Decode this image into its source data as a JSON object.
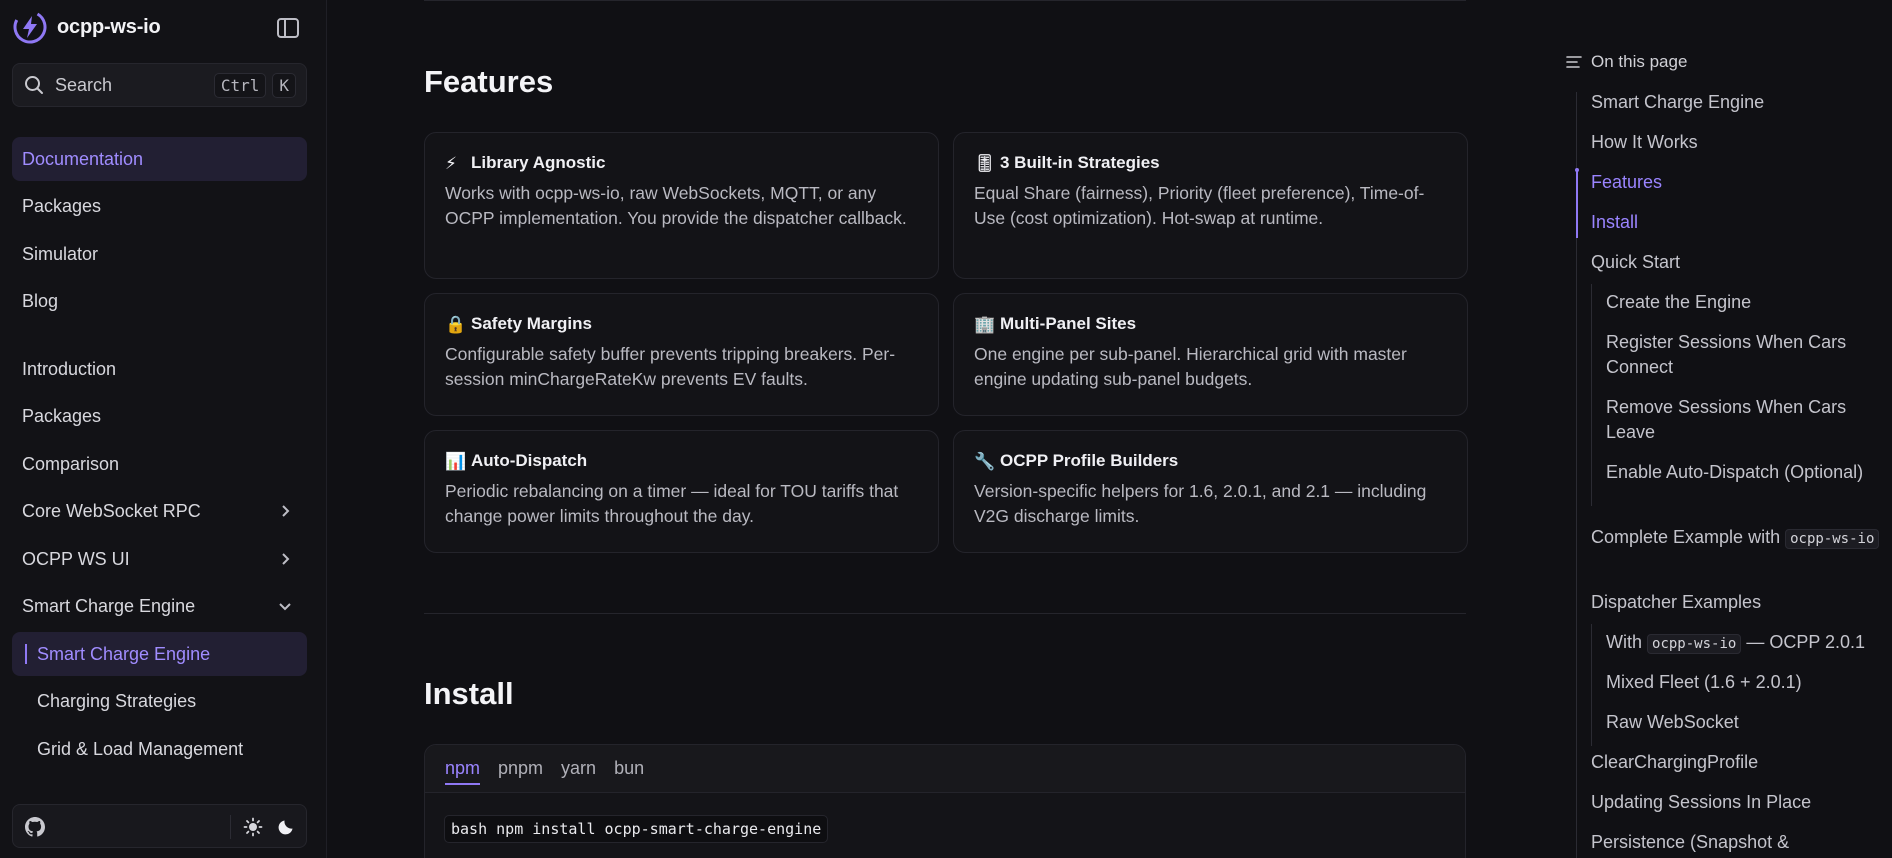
{
  "brand": {
    "name": "ocpp-ws-io"
  },
  "search": {
    "label": "Search",
    "kbd1": "Ctrl",
    "kbd2": "K"
  },
  "nav": {
    "items": [
      {
        "label": "Documentation"
      },
      {
        "label": "Packages"
      },
      {
        "label": "Simulator"
      },
      {
        "label": "Blog"
      },
      {
        "label": "Introduction"
      },
      {
        "label": "Packages"
      },
      {
        "label": "Comparison"
      },
      {
        "label": "Core WebSocket RPC"
      },
      {
        "label": "OCPP WS UI"
      },
      {
        "label": "Smart Charge Engine"
      },
      {
        "label": "Smart Charge Engine"
      },
      {
        "label": "Charging Strategies"
      },
      {
        "label": "Grid & Load Management"
      }
    ]
  },
  "main": {
    "features_heading": "Features",
    "install_heading": "Install",
    "cards": [
      {
        "emoji": "⚡",
        "title": "Library Agnostic",
        "desc": "Works with ocpp-ws-io, raw WebSockets, MQTT, or any OCPP implementation. You provide the dispatcher callback."
      },
      {
        "emoji": "🎚",
        "title": "3 Built-in Strategies",
        "desc": "Equal Share (fairness), Priority (fleet preference), Time-of-Use (cost optimization). Hot-swap at runtime."
      },
      {
        "emoji": "🔒",
        "title": "Safety Margins",
        "desc": "Configurable safety buffer prevents tripping breakers. Per-session minChargeRateKw prevents EV faults."
      },
      {
        "emoji": "🏢",
        "title": "Multi-Panel Sites",
        "desc": "One engine per sub-panel. Hierarchical grid with master engine updating sub-panel budgets."
      },
      {
        "emoji": "📊",
        "title": "Auto-Dispatch",
        "desc": "Periodic rebalancing on a timer — ideal for TOU tariffs that change power limits throughout the day."
      },
      {
        "emoji": "🔧",
        "title": "OCPP Profile Builders",
        "desc": "Version-specific helpers for 1.6, 2.0.1, and 2.1 — including V2G discharge limits."
      }
    ],
    "tabs": [
      "npm",
      "pnpm",
      "yarn",
      "bun"
    ],
    "code": "bash npm install ocpp-smart-charge-engine"
  },
  "toc": {
    "heading": "On this page",
    "items": [
      {
        "label": "Smart Charge Engine"
      },
      {
        "label": "How It Works"
      },
      {
        "label": "Features"
      },
      {
        "label": "Install"
      },
      {
        "label": "Quick Start"
      },
      {
        "label": "Create the Engine"
      },
      {
        "label": "Register Sessions When Cars Connect"
      },
      {
        "label": "Remove Sessions When Cars Leave"
      },
      {
        "label": "Enable Auto-Dispatch (Optional)"
      },
      {
        "label": "Complete Example with ",
        "code": "ocpp-ws-io"
      },
      {
        "label": "Dispatcher Examples"
      },
      {
        "label": "With ",
        "code": "ocpp-ws-io",
        "suffix": " — OCPP 2.0.1"
      },
      {
        "label": "Mixed Fleet (1.6 + 2.0.1)"
      },
      {
        "label": "Raw WebSocket"
      },
      {
        "label": "ClearChargingProfile"
      },
      {
        "label": "Updating Sessions In Place"
      },
      {
        "label": "Persistence (Snapshot &"
      }
    ]
  }
}
